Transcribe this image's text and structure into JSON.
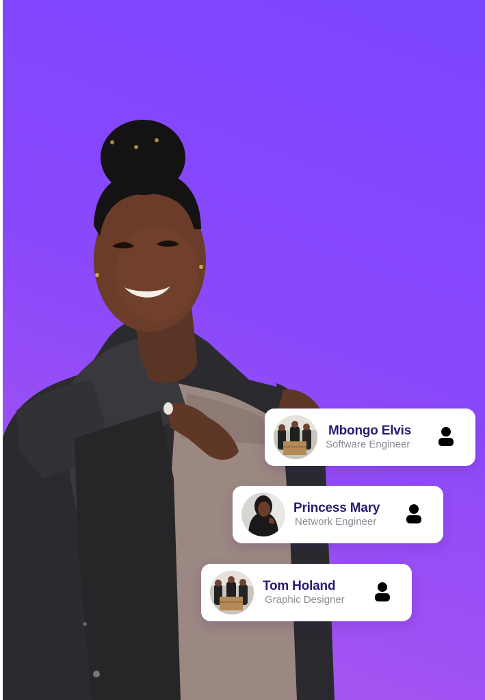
{
  "colors": {
    "gradient_top": "#7a45ff",
    "gradient_bottom": "#b05cf0",
    "name_color": "#2a1a6e",
    "role_color": "#8b8b95"
  },
  "hero": {
    "icon": "woman-portrait"
  },
  "cards": [
    {
      "name": "Mbongo Elvis",
      "role": "Software Engineer",
      "avatar": "team-with-boxes-photo",
      "icon": "user-icon"
    },
    {
      "name": "Princess Mary",
      "role": "Network Engineer",
      "avatar": "woman-portrait-photo",
      "icon": "user-icon"
    },
    {
      "name": "Tom Holand",
      "role": "Graphic Designer",
      "avatar": "team-with-boxes-photo",
      "icon": "user-icon"
    }
  ]
}
